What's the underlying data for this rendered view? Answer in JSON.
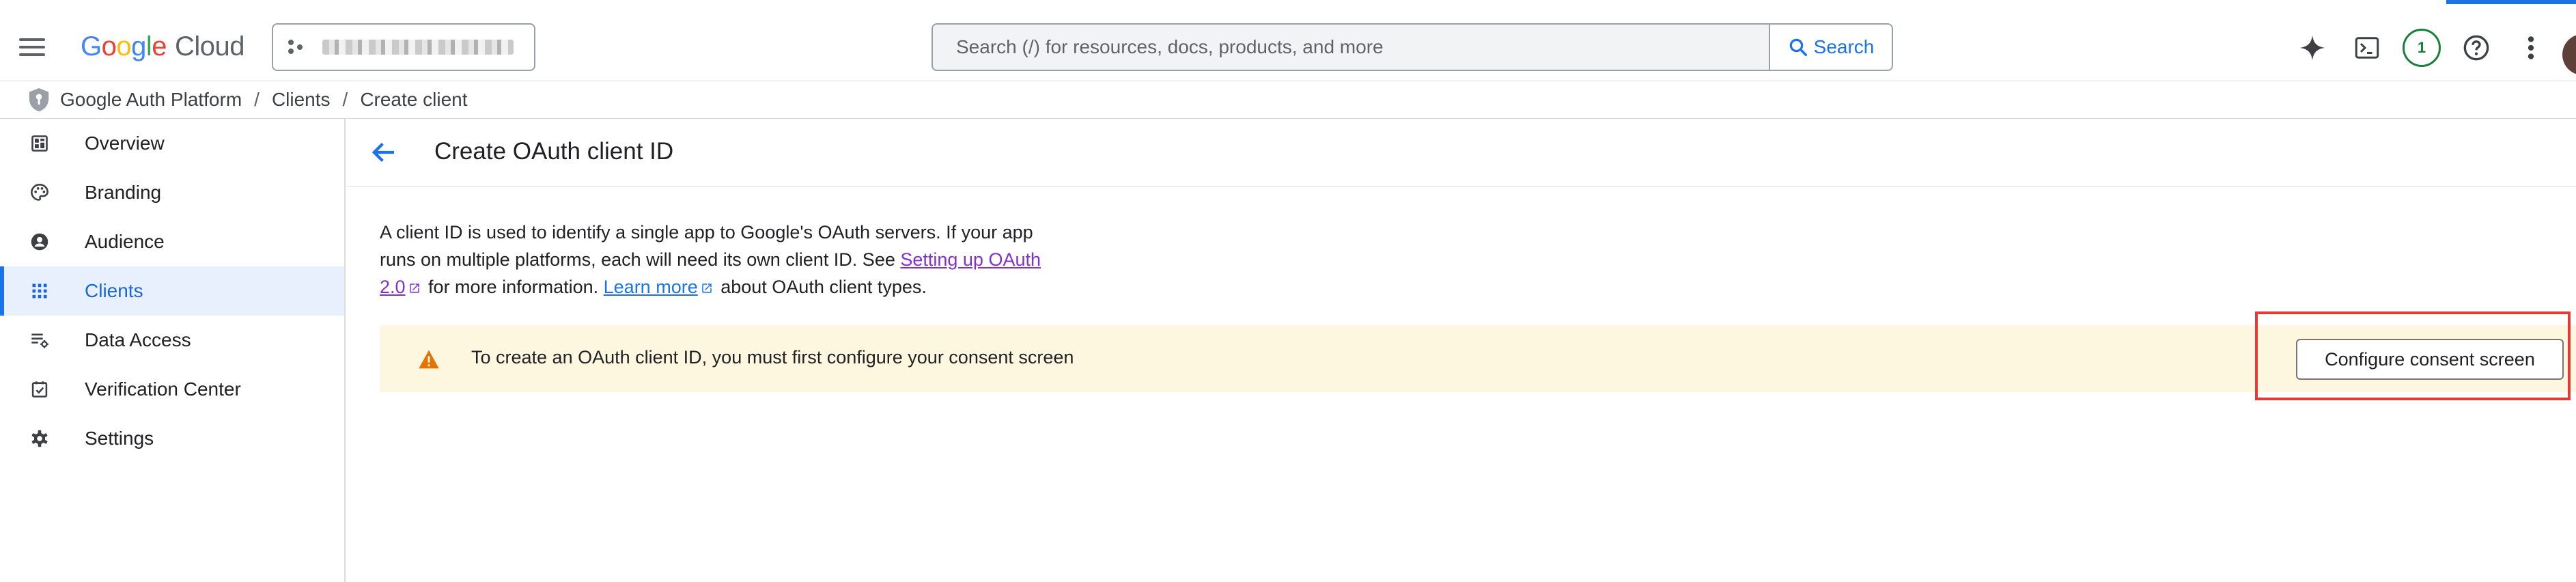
{
  "header": {
    "logo": {
      "letters": [
        "G",
        "o",
        "o",
        "g",
        "l",
        "e"
      ],
      "product": "Cloud"
    },
    "search": {
      "placeholder": "Search (/) for resources, docs, products, and more",
      "button_label": "Search"
    },
    "notifications_count": "1"
  },
  "breadcrumb": [
    "Google Auth Platform",
    "Clients",
    "Create client"
  ],
  "breadcrumb_separator": "/",
  "sidebar": {
    "items": [
      {
        "label": "Overview",
        "icon": "dashboard-icon"
      },
      {
        "label": "Branding",
        "icon": "palette-icon"
      },
      {
        "label": "Audience",
        "icon": "account-circle-icon"
      },
      {
        "label": "Clients",
        "icon": "grid-apps-icon",
        "active": true
      },
      {
        "label": "Data Access",
        "icon": "data-access-icon"
      },
      {
        "label": "Verification Center",
        "icon": "verified-checkbox-icon"
      },
      {
        "label": "Settings",
        "icon": "gear-icon"
      }
    ]
  },
  "main": {
    "title": "Create OAuth client ID",
    "description": {
      "part1": "A client ID is used to identify a single app to Google's OAuth servers. If your app runs on multiple platforms, each will need its own client ID. See ",
      "link1": "Setting up OAuth 2.0",
      "part2": " for more information. ",
      "link2": "Learn more",
      "part3": " about OAuth client types."
    },
    "banner": {
      "text": "To create an OAuth client ID, you must first configure your consent screen",
      "button_label": "Configure consent screen"
    }
  },
  "colors": {
    "accent": "#1a73e8",
    "banner_bg": "#fef7e0",
    "warning": "#e37400",
    "highlight": "#e53935"
  }
}
